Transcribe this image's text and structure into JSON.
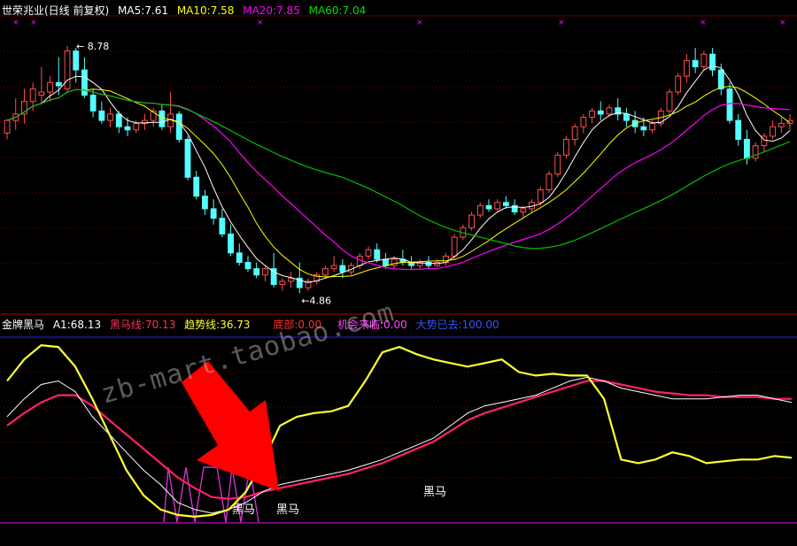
{
  "price_panel": {
    "title": "世荣兆业(日线 前复权)",
    "ma5_label": "MA5:7.61",
    "ma10_label": "MA10:7.58",
    "ma20_label": "MA20:7.85",
    "ma60_label": "MA60:7.04",
    "high_label": "8.78",
    "low_label": "4.86"
  },
  "indicator_panel": {
    "name": "金牌黑马",
    "a1_label": "A1:68.13",
    "heima_label": "黑马线:70.13",
    "trend_label": "趋势线:36.73",
    "bottom_label": "底部:0.00",
    "chance_label": "机会来临:0.00",
    "gone_label": "大势已去:100.00",
    "tag_center": "黑马",
    "tag_left_a": "黑马",
    "tag_left_b": "黑马"
  },
  "watermark": "zb-mart.taobao.com",
  "colors": {
    "bg": "#000000",
    "up": "#ff5050",
    "down": "#54ffff",
    "ma5": "#ffffff",
    "ma10": "#ffff00",
    "ma20": "#ff00ff",
    "ma60": "#00c000",
    "grid": "#800000",
    "a1": "#ffffff",
    "heima": "#ff2266",
    "trend": "#ffff33",
    "bottom_line": "#ff00ff",
    "top_line": "#2020ff",
    "arrow": "#ff0000"
  },
  "chart_data": [
    {
      "type": "candlestick",
      "title": "世荣兆业(日线 前复权)",
      "ylim": [
        4.6,
        9.2
      ],
      "annotations": [
        "8.78",
        "4.86"
      ],
      "candles": [
        [
          7.4,
          7.62,
          7.6,
          7.3
        ],
        [
          7.6,
          7.95,
          7.7,
          7.45
        ],
        [
          7.7,
          8.1,
          7.9,
          7.55
        ],
        [
          7.9,
          8.2,
          8.1,
          7.75
        ],
        [
          8.0,
          8.45,
          8.05,
          7.85
        ],
        [
          8.05,
          8.3,
          8.2,
          7.9
        ],
        [
          8.2,
          8.6,
          8.15,
          8.0
        ],
        [
          8.1,
          8.78,
          8.7,
          8.05
        ],
        [
          8.7,
          8.75,
          8.4,
          8.2
        ],
        [
          8.4,
          8.6,
          8.0,
          7.95
        ],
        [
          8.0,
          8.1,
          7.75,
          7.65
        ],
        [
          7.75,
          7.9,
          7.6,
          7.55
        ],
        [
          7.6,
          7.8,
          7.7,
          7.5
        ],
        [
          7.7,
          7.75,
          7.5,
          7.4
        ],
        [
          7.5,
          7.65,
          7.45,
          7.35
        ],
        [
          7.45,
          7.6,
          7.55,
          7.4
        ],
        [
          7.55,
          7.7,
          7.6,
          7.45
        ],
        [
          7.6,
          7.8,
          7.75,
          7.5
        ],
        [
          7.75,
          7.85,
          7.5,
          7.45
        ],
        [
          7.5,
          8.05,
          7.7,
          7.4
        ],
        [
          7.7,
          7.75,
          7.3,
          7.25
        ],
        [
          7.3,
          7.35,
          6.7,
          6.65
        ],
        [
          6.7,
          6.8,
          6.4,
          6.35
        ],
        [
          6.4,
          6.5,
          6.2,
          6.1
        ],
        [
          6.2,
          6.35,
          6.05,
          5.95
        ],
        [
          6.05,
          6.2,
          5.8,
          5.75
        ],
        [
          5.8,
          5.95,
          5.5,
          5.45
        ],
        [
          5.5,
          5.65,
          5.35,
          5.3
        ],
        [
          5.35,
          5.45,
          5.25,
          5.2
        ],
        [
          5.25,
          5.35,
          5.15,
          5.1
        ],
        [
          5.15,
          5.3,
          5.25,
          5.05
        ],
        [
          5.25,
          5.5,
          5.0,
          4.95
        ],
        [
          5.0,
          5.1,
          5.05,
          4.9
        ],
        [
          5.05,
          5.2,
          5.1,
          4.95
        ],
        [
          5.1,
          5.35,
          4.95,
          4.86
        ],
        [
          4.95,
          5.1,
          5.05,
          4.9
        ],
        [
          5.05,
          5.2,
          5.15,
          5.0
        ],
        [
          5.15,
          5.3,
          5.25,
          5.1
        ],
        [
          5.25,
          5.45,
          5.3,
          5.2
        ],
        [
          5.3,
          5.4,
          5.2,
          5.1
        ],
        [
          5.2,
          5.35,
          5.3,
          5.15
        ],
        [
          5.3,
          5.5,
          5.45,
          5.25
        ],
        [
          5.45,
          5.6,
          5.55,
          5.4
        ],
        [
          5.55,
          5.65,
          5.4,
          5.35
        ],
        [
          5.4,
          5.5,
          5.3,
          5.25
        ],
        [
          5.3,
          5.45,
          5.4,
          5.25
        ],
        [
          5.4,
          5.55,
          5.35,
          5.3
        ],
        [
          5.35,
          5.45,
          5.3,
          5.25
        ],
        [
          5.3,
          5.4,
          5.35,
          5.25
        ],
        [
          5.35,
          5.45,
          5.3,
          5.25
        ],
        [
          5.3,
          5.4,
          5.35,
          5.28
        ],
        [
          5.35,
          5.5,
          5.45,
          5.3
        ],
        [
          5.45,
          5.8,
          5.75,
          5.4
        ],
        [
          5.75,
          5.95,
          5.9,
          5.7
        ],
        [
          5.9,
          6.15,
          6.1,
          5.85
        ],
        [
          6.1,
          6.3,
          6.25,
          6.05
        ],
        [
          6.25,
          6.35,
          6.2,
          6.15
        ],
        [
          6.2,
          6.35,
          6.3,
          6.15
        ],
        [
          6.3,
          6.4,
          6.25,
          6.2
        ],
        [
          6.25,
          6.35,
          6.15,
          6.1
        ],
        [
          6.15,
          6.25,
          6.2,
          6.05
        ],
        [
          6.2,
          6.35,
          6.3,
          6.15
        ],
        [
          6.3,
          6.55,
          6.5,
          6.25
        ],
        [
          6.5,
          6.8,
          6.75,
          6.45
        ],
        [
          6.75,
          7.1,
          7.05,
          6.7
        ],
        [
          7.05,
          7.35,
          7.3,
          7.0
        ],
        [
          7.3,
          7.55,
          7.5,
          7.2
        ],
        [
          7.5,
          7.7,
          7.65,
          7.4
        ],
        [
          7.65,
          7.8,
          7.75,
          7.55
        ],
        [
          7.75,
          7.9,
          7.7,
          7.6
        ],
        [
          7.7,
          7.85,
          7.8,
          7.65
        ],
        [
          7.8,
          7.95,
          7.7,
          7.6
        ],
        [
          7.7,
          7.8,
          7.6,
          7.5
        ],
        [
          7.6,
          7.75,
          7.5,
          7.4
        ],
        [
          7.5,
          7.65,
          7.45,
          7.35
        ],
        [
          7.45,
          7.6,
          7.55,
          7.4
        ],
        [
          7.55,
          7.8,
          7.75,
          7.5
        ],
        [
          7.75,
          8.1,
          8.05,
          7.7
        ],
        [
          8.05,
          8.35,
          8.3,
          8.0
        ],
        [
          8.3,
          8.65,
          8.55,
          8.2
        ],
        [
          8.55,
          8.75,
          8.45,
          8.35
        ],
        [
          8.45,
          8.7,
          8.65,
          8.4
        ],
        [
          8.65,
          8.75,
          8.4,
          8.3
        ],
        [
          8.4,
          8.5,
          8.1,
          8.0
        ],
        [
          8.1,
          8.2,
          7.6,
          7.55
        ],
        [
          7.6,
          7.7,
          7.3,
          7.2
        ],
        [
          7.3,
          7.45,
          7.0,
          6.9
        ],
        [
          7.0,
          7.25,
          7.2,
          6.95
        ],
        [
          7.2,
          7.4,
          7.35,
          7.1
        ],
        [
          7.35,
          7.6,
          7.5,
          7.3
        ],
        [
          7.5,
          7.65,
          7.55,
          7.4
        ],
        [
          7.55,
          7.7,
          7.6,
          7.45
        ]
      ]
    },
    {
      "type": "line",
      "title": "金牌黑马",
      "ylim": [
        0,
        105
      ],
      "series": [
        {
          "name": "A1",
          "values": [
            60,
            70,
            78,
            80,
            74,
            60,
            50,
            40,
            30,
            22,
            12,
            8,
            6,
            8,
            12,
            18,
            22,
            24,
            26,
            28,
            30,
            33,
            36,
            40,
            44,
            48,
            55,
            62,
            66,
            68,
            70,
            72,
            76,
            80,
            82,
            80,
            76,
            74,
            72,
            70,
            70,
            70,
            71,
            72,
            72,
            70,
            68
          ]
        },
        {
          "name": "黑马线",
          "values": [
            55,
            62,
            68,
            72,
            72,
            66,
            58,
            50,
            42,
            34,
            26,
            20,
            15,
            14,
            15,
            18,
            20,
            22,
            24,
            26,
            28,
            31,
            34,
            38,
            42,
            46,
            52,
            58,
            62,
            65,
            68,
            71,
            74,
            77,
            80,
            80,
            78,
            76,
            74,
            73,
            72,
            72,
            71,
            71,
            71,
            70,
            70
          ]
        },
        {
          "name": "趋势线",
          "values": [
            80,
            92,
            100,
            99,
            88,
            70,
            50,
            30,
            16,
            8,
            5,
            4,
            5,
            8,
            18,
            35,
            55,
            60,
            62,
            63,
            66,
            80,
            96,
            99,
            95,
            92,
            90,
            88,
            90,
            92,
            85,
            83,
            84,
            83,
            83,
            70,
            36,
            34,
            36,
            40,
            38,
            34,
            35,
            36,
            36,
            38,
            37
          ]
        }
      ]
    }
  ]
}
